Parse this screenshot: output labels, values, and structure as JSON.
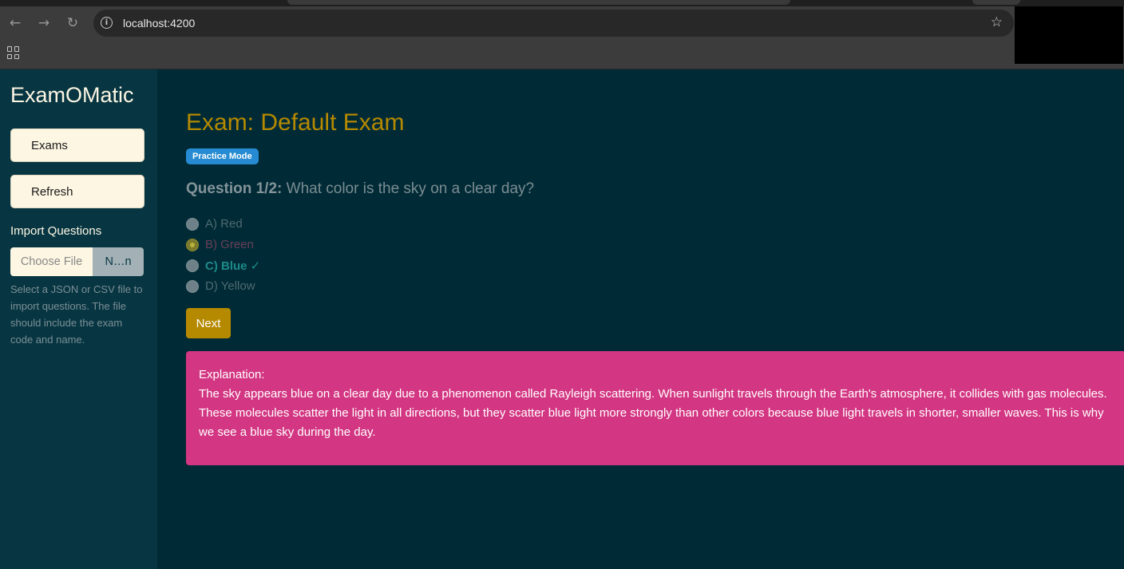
{
  "browser": {
    "url": "localhost:4200",
    "back_icon": "arrow-left-icon",
    "forward_icon": "arrow-right-icon",
    "reload_icon": "reload-icon",
    "info_icon": "info-icon",
    "star_icon": "star-icon",
    "apps_icon": "apps-grid-icon"
  },
  "sidebar": {
    "app_title": "ExamOMatic",
    "exams_label": "Exams",
    "refresh_label": "Refresh",
    "import_label": "Import Questions",
    "choose_file_label": "Choose File",
    "file_name": "N…n",
    "help_text": "Select a JSON or CSV file to import questions. The file should include the exam code and name."
  },
  "main": {
    "exam_title": "Exam: Default Exam",
    "mode_badge": "Practice Mode",
    "question_number": "Question 1/2:",
    "question_text": "What color is the sky on a clear day?",
    "options": [
      {
        "label": "A) Red",
        "selected": false,
        "correct": false
      },
      {
        "label": "B) Green",
        "selected": true,
        "correct": false
      },
      {
        "label": "C) Blue ✓",
        "selected": false,
        "correct": true
      },
      {
        "label": "D) Yellow",
        "selected": false,
        "correct": false
      }
    ],
    "next_label": "Next",
    "explanation_title": "Explanation:",
    "explanation_text": "The sky appears blue on a clear day due to a phenomenon called Rayleigh scattering. When sunlight travels through the Earth's atmosphere, it collides with gas molecules. These molecules scatter the light in all directions, but they scatter blue light more strongly than other colors because blue light travels in shorter, smaller waves. This is why we see a blue sky during the day."
  },
  "colors": {
    "background": "#002b36",
    "sidebar": "#073642",
    "accent": "#b58900",
    "badge": "#268bd2",
    "explanation": "#d33682",
    "light": "#fdf6e3"
  }
}
